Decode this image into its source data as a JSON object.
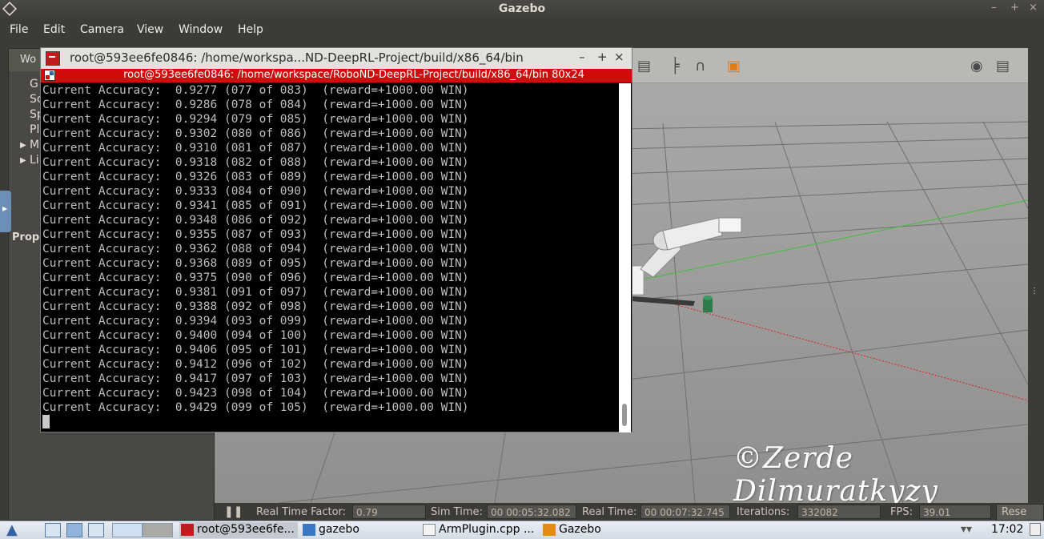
{
  "window": {
    "title": "Gazebo"
  },
  "menu": [
    "File",
    "Edit",
    "Camera",
    "View",
    "Window",
    "Help"
  ],
  "left_panel": {
    "tab_label": "Wo",
    "rows": [
      {
        "label": "G",
        "expandable": false
      },
      {
        "label": "Sc",
        "expandable": false
      },
      {
        "label": "Sp",
        "expandable": false
      },
      {
        "label": "Pl",
        "expandable": false
      },
      {
        "label": "M",
        "expandable": true
      },
      {
        "label": "Li",
        "expandable": true
      }
    ],
    "properties_label": "Prop"
  },
  "terminal": {
    "title": "root@593ee6fe0846: /home/workspa...ND-DeepRL-Project/build/x86_64/bin",
    "tab_title": "root@593ee6fe0846: /home/workspace/RoboND-DeepRL-Project/build/x86_64/bin 80x24",
    "lines": [
      "Current Accuracy:  0.9277 (077 of 083)  (reward=+1000.00 WIN)",
      "Current Accuracy:  0.9286 (078 of 084)  (reward=+1000.00 WIN)",
      "Current Accuracy:  0.9294 (079 of 085)  (reward=+1000.00 WIN)",
      "Current Accuracy:  0.9302 (080 of 086)  (reward=+1000.00 WIN)",
      "Current Accuracy:  0.9310 (081 of 087)  (reward=+1000.00 WIN)",
      "Current Accuracy:  0.9318 (082 of 088)  (reward=+1000.00 WIN)",
      "Current Accuracy:  0.9326 (083 of 089)  (reward=+1000.00 WIN)",
      "Current Accuracy:  0.9333 (084 of 090)  (reward=+1000.00 WIN)",
      "Current Accuracy:  0.9341 (085 of 091)  (reward=+1000.00 WIN)",
      "Current Accuracy:  0.9348 (086 of 092)  (reward=+1000.00 WIN)",
      "Current Accuracy:  0.9355 (087 of 093)  (reward=+1000.00 WIN)",
      "Current Accuracy:  0.9362 (088 of 094)  (reward=+1000.00 WIN)",
      "Current Accuracy:  0.9368 (089 of 095)  (reward=+1000.00 WIN)",
      "Current Accuracy:  0.9375 (090 of 096)  (reward=+1000.00 WIN)",
      "Current Accuracy:  0.9381 (091 of 097)  (reward=+1000.00 WIN)",
      "Current Accuracy:  0.9388 (092 of 098)  (reward=+1000.00 WIN)",
      "Current Accuracy:  0.9394 (093 of 099)  (reward=+1000.00 WIN)",
      "Current Accuracy:  0.9400 (094 of 100)  (reward=+1000.00 WIN)",
      "Current Accuracy:  0.9406 (095 of 101)  (reward=+1000.00 WIN)",
      "Current Accuracy:  0.9412 (096 of 102)  (reward=+1000.00 WIN)",
      "Current Accuracy:  0.9417 (097 of 103)  (reward=+1000.00 WIN)",
      "Current Accuracy:  0.9423 (098 of 104)  (reward=+1000.00 WIN)",
      "Current Accuracy:  0.9429 (099 of 105)  (reward=+1000.00 WIN)"
    ]
  },
  "watermark": "©Zerde Dilmuratkyzy",
  "status": {
    "real_time_factor_label": "Real Time Factor:",
    "real_time_factor": "0.79",
    "sim_time_label": "Sim Time:",
    "sim_time": "00 00:05:32.082",
    "real_time_label": "Real Time:",
    "real_time": "00 00:07:32.745",
    "iterations_label": "Iterations:",
    "iterations": "332082",
    "fps_label": "FPS:",
    "fps": "39.01",
    "reset_label": "Rese"
  },
  "taskbar": {
    "tasks": [
      {
        "label": "root@593ee6fe...",
        "icon": "terminal-icon",
        "color": "#c01c20"
      },
      {
        "label": "gazebo",
        "icon": "folder-icon",
        "color": "#3a78c4"
      },
      {
        "label": "ArmPlugin.cpp ...",
        "icon": "text-editor-icon",
        "color": "#888888"
      },
      {
        "label": "Gazebo",
        "icon": "gazebo-icon",
        "color": "#e38a1a"
      }
    ],
    "clock": "17:02"
  },
  "colors": {
    "terminal_tab_bg": "#d10c0c",
    "terminal_text": "#bdbdbd",
    "viewport_ground": "#8c8c8b"
  }
}
